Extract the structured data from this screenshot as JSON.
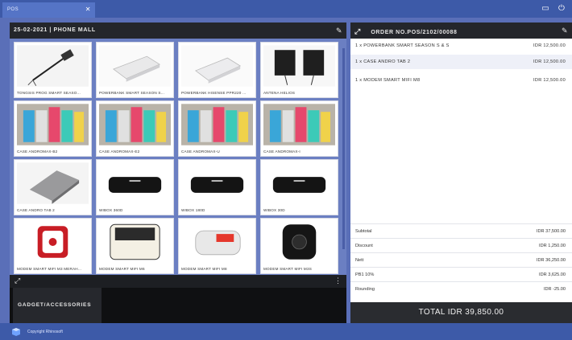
{
  "tab": {
    "label": "POS",
    "close_icon": "close-icon"
  },
  "top_icons": [
    "window-icon",
    "power-icon"
  ],
  "product_panel": {
    "header": "25-02-2021 | PHONE MALL",
    "products": [
      {
        "label": "TONGSIS PROG SMART SEASO...",
        "icon": "selfie-stick-icon"
      },
      {
        "label": "POWERBANK SMART SEASON S...",
        "icon": "powerbank-icon"
      },
      {
        "label": "POWERBANK HISENSE PPR220 ...",
        "icon": "powerbank-icon"
      },
      {
        "label": "ANTENA HELIOS",
        "icon": "antenna-icon"
      },
      {
        "label": "CASE ANDROMAX-B2",
        "icon": "phone-case-icon"
      },
      {
        "label": "CASE ANDROMAX-E2",
        "icon": "phone-case-icon"
      },
      {
        "label": "CASE ANDROMAX-U",
        "icon": "phone-case-icon"
      },
      {
        "label": "CASE ANDROMAX-I",
        "icon": "phone-case-icon"
      },
      {
        "label": "CASE ANDRO TAB 2",
        "icon": "tablet-case-icon"
      },
      {
        "label": "WIBOX 360D",
        "icon": "wibox-icon"
      },
      {
        "label": "WIBOX 180D",
        "icon": "wibox-icon"
      },
      {
        "label": "WIBOX 30D",
        "icon": "wibox-icon"
      },
      {
        "label": "MODEM SMART MIFI M3 MERAH...",
        "icon": "mifi-red-icon"
      },
      {
        "label": "MODEM SMART MIFI M6",
        "icon": "mifi-icon"
      },
      {
        "label": "MODEM SMART MIFI M8",
        "icon": "mifi-icon"
      },
      {
        "label": "MODEM SMART MIFI M3S",
        "icon": "mifi-black-icon"
      }
    ],
    "category": "GADGET/ACCESSORIES"
  },
  "order_panel": {
    "header": "ORDER NO.POS/2102/00088",
    "items": [
      {
        "name": "1 x POWERBANK SMART SEASON S & S",
        "price": "IDR 12,500.00"
      },
      {
        "name": "1 x CASE ANDRO TAB 2",
        "price": "IDR 12,500.00"
      },
      {
        "name": "1 x MODEM SMART MIFI M8",
        "price": "IDR 12,500.00"
      }
    ],
    "summary": [
      {
        "key": "Subtotal",
        "value": "IDR 37,500.00"
      },
      {
        "key": "Discount",
        "value": "IDR 1,250.00"
      },
      {
        "key": "Nett",
        "value": "IDR 36,250.00"
      },
      {
        "key": "PB1 10%",
        "value": "IDR 3,625.00"
      },
      {
        "key": "Rounding",
        "value": "IDR -25.00"
      }
    ],
    "total": "TOTAL IDR 39,850.00"
  },
  "footer": {
    "text": "Copyright Rhinosoft"
  },
  "colors": {
    "accent": "#3d5aa8",
    "panel": "#24262b",
    "selected_row": "#eef0f8"
  }
}
